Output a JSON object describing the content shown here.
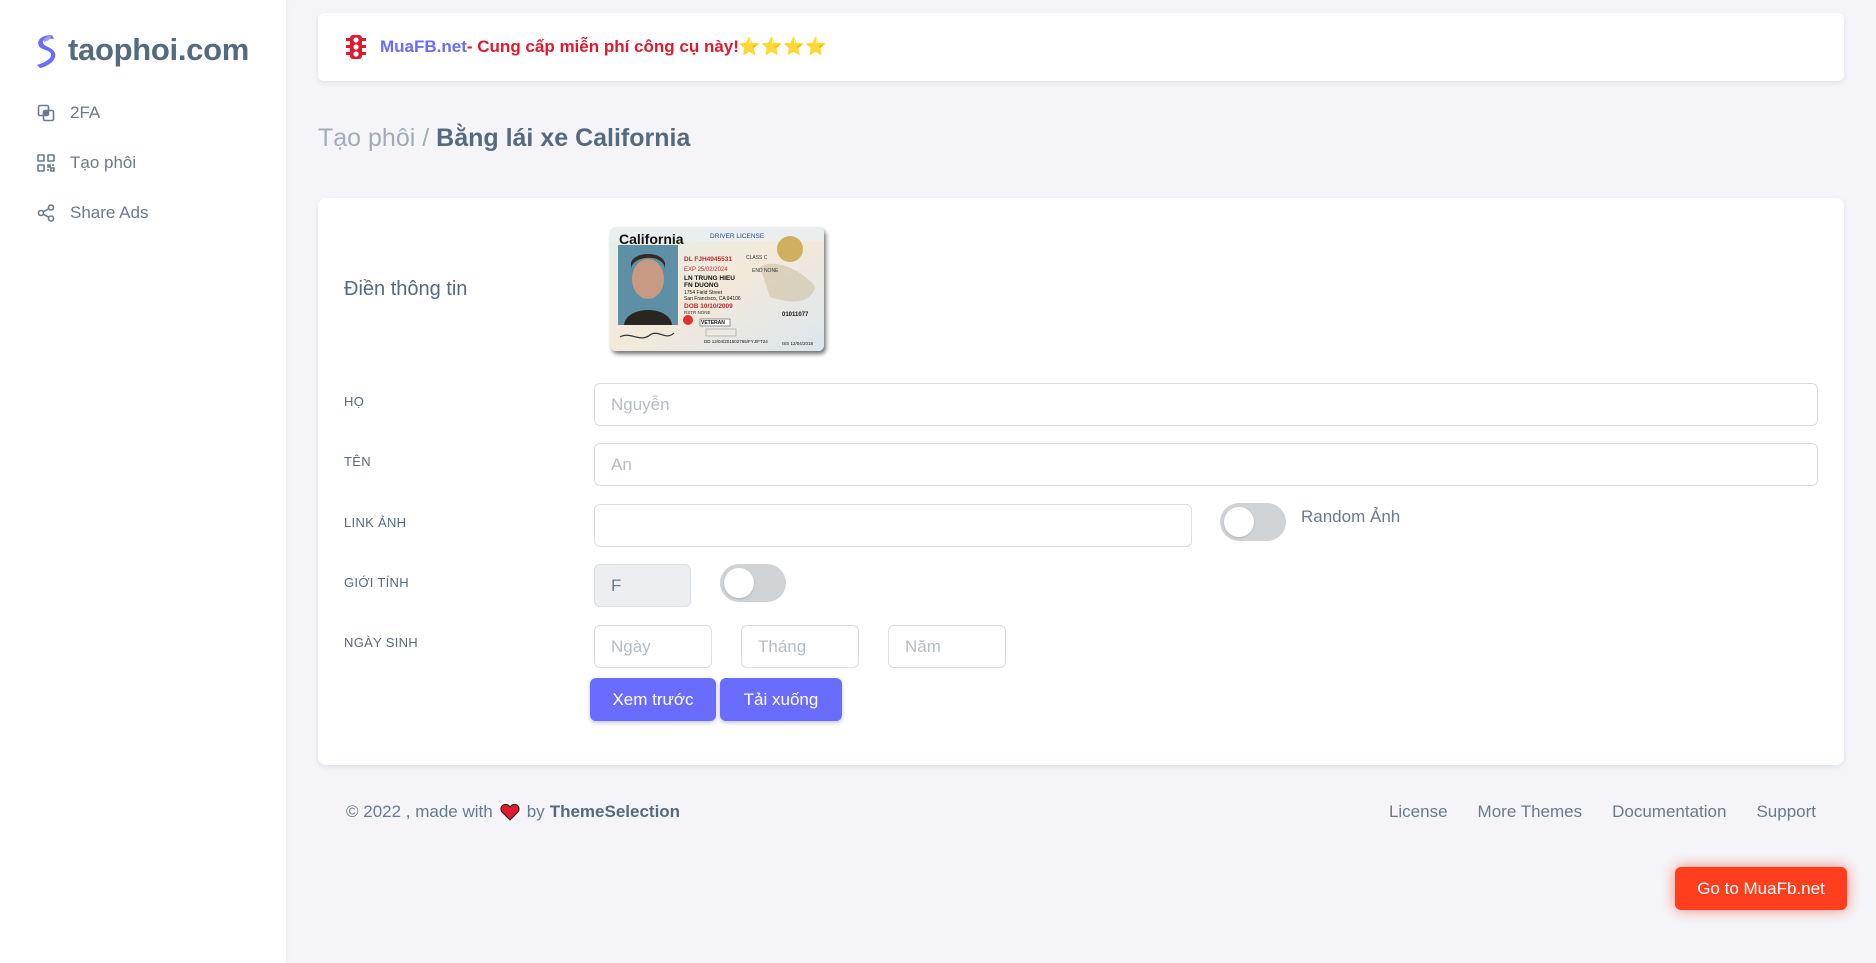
{
  "brand": {
    "name": "taophoi.com",
    "logo_icon": "brand-s-logo-icon"
  },
  "sidebar": {
    "items": [
      {
        "label": "2FA",
        "icon": "copy-icon"
      },
      {
        "label": "Tạo phôi",
        "icon": "qr-code-icon"
      },
      {
        "label": "Share Ads",
        "icon": "share-icon"
      }
    ]
  },
  "notice": {
    "icon": "traffic-light-icon",
    "link_text": "MuaFB.net",
    "message": " - Cung cấp miễn phí công cụ này!",
    "stars": "⭐⭐⭐⭐"
  },
  "breadcrumb": {
    "parent": "Tạo phôi",
    "separator": " / ",
    "current": "Bằng lái xe California"
  },
  "form": {
    "heading": "Điền thông tin",
    "license_preview": {
      "state": "California",
      "doc_type": "DRIVER LICENSE",
      "dl_number": "DL FJH4945531",
      "exp": "EXP 25/02/2024",
      "class": "CLASS C",
      "last_name": "LN TRUNG HIEU",
      "first_name": "FN DUONG",
      "address1": "1754 Field Street",
      "address2": "San Francisco, CA 94106",
      "dob": "DOB 10/10/2009",
      "rstr": "RSTR NONE",
      "end": "END NONE",
      "veteran": "VETERAN",
      "doc_no": "01011077",
      "dd": "DD 12/04/201502765/FYJ/FT24",
      "iss": "ISS 12/04/2018"
    },
    "last_name": {
      "label": "HỌ",
      "placeholder": "Nguyễn",
      "value": ""
    },
    "first_name": {
      "label": "TÊN",
      "placeholder": "An",
      "value": ""
    },
    "photo_link": {
      "label": "LINK ẢNH",
      "placeholder": "",
      "value": "",
      "random_label": "Random Ảnh",
      "random_on": false
    },
    "gender": {
      "label": "GIỚI TÍNH",
      "value": "F",
      "toggle_on": false
    },
    "birth_date": {
      "label": "NGÀY SINH",
      "day_placeholder": "Ngày",
      "month_placeholder": "Tháng",
      "year_placeholder": "Năm"
    },
    "preview_button": "Xem trước",
    "download_button": "Tải xuống"
  },
  "footer": {
    "copyright": "© 2022 , made with",
    "by": "by",
    "author": "ThemeSelection",
    "links": [
      "License",
      "More Themes",
      "Documentation",
      "Support"
    ]
  },
  "cta_button": "Go to MuaFb.net",
  "colors": {
    "primary": "#696cff",
    "danger": "#ff3e1d",
    "notice_red": "#e0192f",
    "text": "#566a7f",
    "background": "#f5f5f9"
  }
}
